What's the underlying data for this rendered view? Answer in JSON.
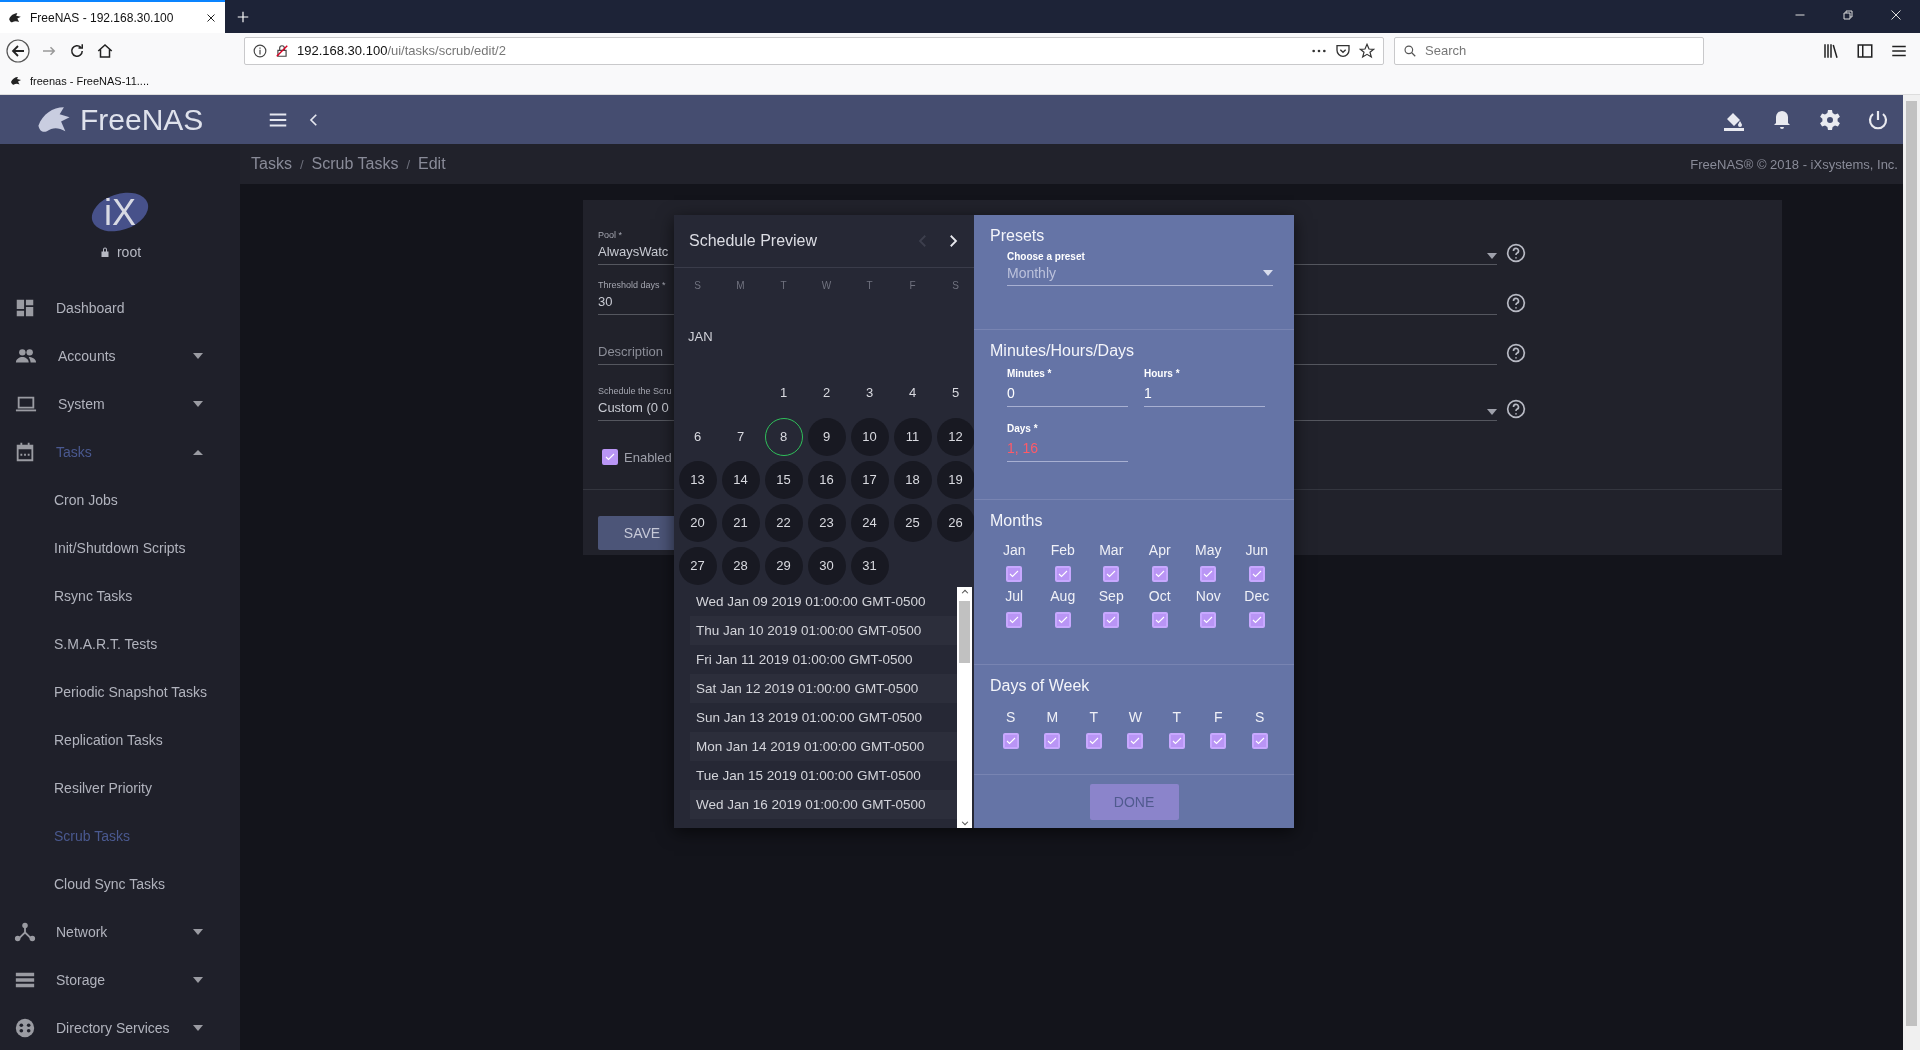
{
  "browser": {
    "tab_title": "FreeNAS - 192.168.30.100",
    "url_host": "192.168.30.100",
    "url_path": "/ui/tasks/scrub/edit/2",
    "search_placeholder": "Search",
    "bookmark": "freenas - FreeNAS-11...."
  },
  "header": {
    "logo": "FreeNAS"
  },
  "breadcrumb": [
    {
      "label": "Tasks",
      "separator": "/"
    },
    {
      "label": "Scrub Tasks",
      "separator": "/"
    },
    {
      "label": "Edit"
    }
  ],
  "copyright": "FreeNAS® © 2018 - iXsystems, Inc.",
  "sidebar": {
    "logo": "iX",
    "user": "root",
    "items": [
      {
        "label": "Dashboard",
        "selected": false
      },
      {
        "label": "Accounts",
        "selected": false,
        "expanded": false
      },
      {
        "label": "System",
        "selected": false,
        "expanded": false
      },
      {
        "label": "Tasks",
        "selected": true,
        "expanded": true,
        "children": [
          {
            "label": "Cron Jobs",
            "selected": false
          },
          {
            "label": "Init/Shutdown Scripts",
            "selected": false
          },
          {
            "label": "Rsync Tasks",
            "selected": false
          },
          {
            "label": "S.M.A.R.T. Tests",
            "selected": false
          },
          {
            "label": "Periodic Snapshot Tasks",
            "selected": false
          },
          {
            "label": "Replication Tasks",
            "selected": false
          },
          {
            "label": "Resilver Priority",
            "selected": false
          },
          {
            "label": "Scrub Tasks",
            "selected": true
          },
          {
            "label": "Cloud Sync Tasks",
            "selected": false
          }
        ]
      },
      {
        "label": "Network",
        "selected": false,
        "expanded": false
      },
      {
        "label": "Storage",
        "selected": false,
        "expanded": false
      },
      {
        "label": "Directory Services",
        "selected": false,
        "expanded": false
      }
    ]
  },
  "form": {
    "fields": [
      {
        "kind": "select",
        "label": "Pool *",
        "value": "AlwaysWatc"
      },
      {
        "kind": "input",
        "label": "Threshold days *",
        "value": "30"
      },
      {
        "kind": "input",
        "placeholder": "Description"
      },
      {
        "kind": "select",
        "label": "Schedule the Scru",
        "value": "Custom (0 0"
      }
    ],
    "enabled": {
      "label": "Enabled",
      "checked": true
    },
    "save": "SAVE"
  },
  "schedule": {
    "title": "Schedule Preview",
    "prev_disabled": true,
    "next_disabled": false,
    "weekdays": [
      "S",
      "M",
      "T",
      "W",
      "T",
      "F",
      "S"
    ],
    "month": "JAN",
    "weeks": [
      [
        {
          "label": "1",
          "today": false,
          "highlighted": false
        },
        {
          "label": "2",
          "today": false,
          "highlighted": false
        },
        {
          "label": "3",
          "today": false,
          "highlighted": false
        },
        {
          "label": "4",
          "today": false,
          "highlighted": false
        },
        {
          "label": "5",
          "today": false,
          "highlighted": false
        }
      ],
      [
        {
          "label": "6",
          "today": false,
          "highlighted": false
        },
        {
          "label": "7",
          "today": false,
          "highlighted": false
        },
        {
          "label": "8",
          "today": true,
          "highlighted": false
        },
        {
          "label": "9",
          "today": false,
          "highlighted": true
        },
        {
          "label": "10",
          "today": false,
          "highlighted": true
        },
        {
          "label": "11",
          "today": false,
          "highlighted": true
        },
        {
          "label": "12",
          "today": false,
          "highlighted": true
        }
      ],
      [
        {
          "label": "13",
          "today": false,
          "highlighted": true
        },
        {
          "label": "14",
          "today": false,
          "highlighted": true
        },
        {
          "label": "15",
          "today": false,
          "highlighted": true
        },
        {
          "label": "16",
          "today": false,
          "highlighted": true
        },
        {
          "label": "17",
          "today": false,
          "highlighted": true
        },
        {
          "label": "18",
          "today": false,
          "highlighted": true
        },
        {
          "label": "19",
          "today": false,
          "highlighted": true
        }
      ],
      [
        {
          "label": "20",
          "today": false,
          "highlighted": true
        },
        {
          "label": "21",
          "today": false,
          "highlighted": true
        },
        {
          "label": "22",
          "today": false,
          "highlighted": true
        },
        {
          "label": "23",
          "today": false,
          "highlighted": true
        },
        {
          "label": "24",
          "today": false,
          "highlighted": true
        },
        {
          "label": "25",
          "today": false,
          "highlighted": true
        },
        {
          "label": "26",
          "today": false,
          "highlighted": true
        }
      ],
      [
        {
          "label": "27",
          "today": false,
          "highlighted": true
        },
        {
          "label": "28",
          "today": false,
          "highlighted": true
        },
        {
          "label": "29",
          "today": false,
          "highlighted": true
        },
        {
          "label": "30",
          "today": false,
          "highlighted": true
        },
        {
          "label": "31",
          "today": false,
          "highlighted": true
        }
      ]
    ],
    "dates": [
      "Wed Jan 09 2019 01:00:00 GMT-0500",
      "Thu Jan 10 2019 01:00:00 GMT-0500",
      "Fri Jan 11 2019 01:00:00 GMT-0500",
      "Sat Jan 12 2019 01:00:00 GMT-0500",
      "Sun Jan 13 2019 01:00:00 GMT-0500",
      "Mon Jan 14 2019 01:00:00 GMT-0500",
      "Tue Jan 15 2019 01:00:00 GMT-0500",
      "Wed Jan 16 2019 01:00:00 GMT-0500"
    ]
  },
  "panel": {
    "presets": {
      "title": "Presets",
      "label": "Choose a preset",
      "value": "Monthly"
    },
    "mhd": {
      "title": "Minutes/Hours/Days",
      "fields": [
        {
          "label": "Minutes *",
          "value": "0",
          "error": false
        },
        {
          "label": "Hours *",
          "value": "1",
          "error": false
        },
        {
          "label": "Days *",
          "value": "1, 16",
          "error": true
        }
      ]
    },
    "months": {
      "title": "Months",
      "items": [
        {
          "label": "Jan",
          "checked": true
        },
        {
          "label": "Feb",
          "checked": true
        },
        {
          "label": "Mar",
          "checked": true
        },
        {
          "label": "Apr",
          "checked": true
        },
        {
          "label": "May",
          "checked": true
        },
        {
          "label": "Jun",
          "checked": true
        },
        {
          "label": "Jul",
          "checked": true
        },
        {
          "label": "Aug",
          "checked": true
        },
        {
          "label": "Sep",
          "checked": true
        },
        {
          "label": "Oct",
          "checked": true
        },
        {
          "label": "Nov",
          "checked": true
        },
        {
          "label": "Dec",
          "checked": true
        }
      ]
    },
    "weekdays": {
      "title": "Days of Week",
      "items": [
        {
          "label": "S",
          "checked": true
        },
        {
          "label": "M",
          "checked": true
        },
        {
          "label": "T",
          "checked": true
        },
        {
          "label": "W",
          "checked": true
        },
        {
          "label": "T",
          "checked": true
        },
        {
          "label": "F",
          "checked": true
        },
        {
          "label": "S",
          "checked": true
        }
      ]
    },
    "done": {
      "label": "DONE",
      "disabled": true
    }
  }
}
